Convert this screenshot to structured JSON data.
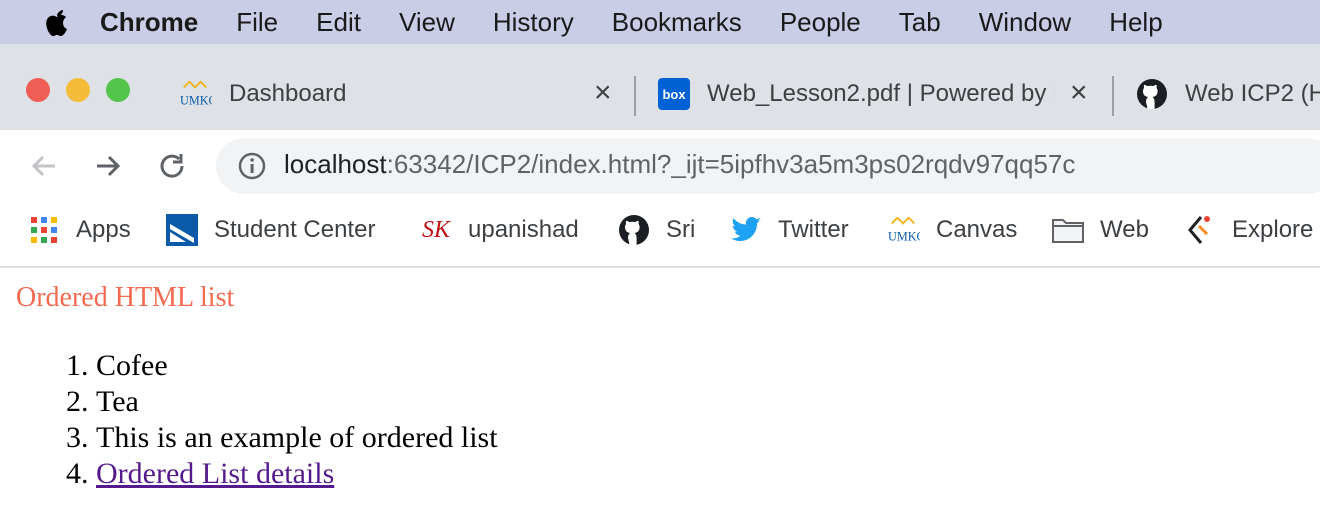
{
  "menubar": {
    "app_name": "Chrome",
    "items": [
      "File",
      "Edit",
      "View",
      "History",
      "Bookmarks",
      "People",
      "Tab",
      "Window",
      "Help"
    ]
  },
  "tabs": [
    {
      "title": "Dashboard",
      "favicon": "umkc-logo-icon",
      "favicon_text": "UMKC"
    },
    {
      "title": "Web_Lesson2.pdf | Powered by Box",
      "favicon": "box-icon",
      "favicon_text": "box"
    },
    {
      "title": "Web ICP2 (H",
      "favicon": "github-icon"
    }
  ],
  "toolbar": {
    "url_host": "localhost",
    "url_rest": ":63342/ICP2/index.html?_ijt=5ipfhv3a5m3ps02rqdv97qq57c"
  },
  "bookmarks": [
    {
      "label": "Apps",
      "icon": "apps-grid-icon"
    },
    {
      "label": "Student Center",
      "icon": "student-center-icon"
    },
    {
      "label": "upanishad",
      "icon": "sk-logo-icon",
      "icon_text": "SK"
    },
    {
      "label": "Sri",
      "icon": "github-icon"
    },
    {
      "label": "Twitter",
      "icon": "twitter-icon"
    },
    {
      "label": "Canvas",
      "icon": "umkc-logo-icon",
      "icon_text": "UMKC"
    },
    {
      "label": "Web",
      "icon": "folder-icon"
    },
    {
      "label": "Explore",
      "icon": "explore-icon"
    }
  ],
  "page": {
    "heading": "Ordered HTML list",
    "list_items": [
      "Cofee",
      "Tea",
      "This is an example of ordered list",
      "Ordered List details"
    ]
  },
  "colors": {
    "heading": "#f26b50",
    "link_visited": "#551a8b",
    "menubar_bg": "#c9cde6",
    "tabstrip_bg": "#dee1e6"
  }
}
